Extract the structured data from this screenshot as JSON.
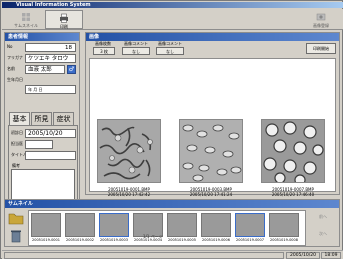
{
  "window": {
    "title": "Visual Information System"
  },
  "toolbar": {
    "items": [
      {
        "label": "サムスネイル",
        "active": false
      },
      {
        "label": "印刷",
        "active": true
      },
      {
        "label": "画像登録",
        "active": false
      }
    ]
  },
  "left_panel": {
    "header": "患者情報",
    "fields": [
      {
        "label": "No",
        "value": "18"
      },
      {
        "label": "フリガナ",
        "value": "ケツエキ タロウ"
      },
      {
        "label": "名前",
        "value": "血液 太郎"
      },
      {
        "label": "生年月日",
        "value": ""
      },
      {
        "label": "",
        "value": "年  月  日"
      }
    ],
    "tabs": [
      "基本",
      "所見",
      "症状"
    ],
    "tab_fields": [
      {
        "label": "初診日",
        "value": "2005/10/20"
      },
      {
        "label": "担当医",
        "value": ""
      },
      {
        "label": "タイトル",
        "value": ""
      },
      {
        "label": "備考",
        "value": ""
      }
    ],
    "register_button": "登録"
  },
  "center_panel": {
    "header": "画像",
    "controls": [
      {
        "label": "画像枚数",
        "value": "3 枚"
      },
      {
        "label": "画像コメント",
        "value": "なし"
      },
      {
        "label": "画像コメント",
        "value": "なし"
      }
    ],
    "print_button": "印刷開始",
    "images": [
      {
        "name": "20051019-0001.BMP",
        "date": "2005/10/20 17:42:42"
      },
      {
        "name": "20051019-0003.BMP",
        "date": "2005/10/20 17:41:24"
      },
      {
        "name": "20051019-0007.BMP",
        "date": "2005/10/20 17:46:40"
      }
    ]
  },
  "thumbnail_panel": {
    "header": "サムネイル",
    "thumbnails": [
      "20051019-0001",
      "20051019-0002",
      "20051019-0003",
      "20051019-0004",
      "20051019-0005",
      "20051019-0006",
      "20051019-0007",
      "20051019-0008"
    ],
    "page_label": "1/1 ページ",
    "nav": [
      "前へ",
      "次へ"
    ]
  },
  "status": {
    "date": "2005/10/20",
    "time": "18:09"
  }
}
